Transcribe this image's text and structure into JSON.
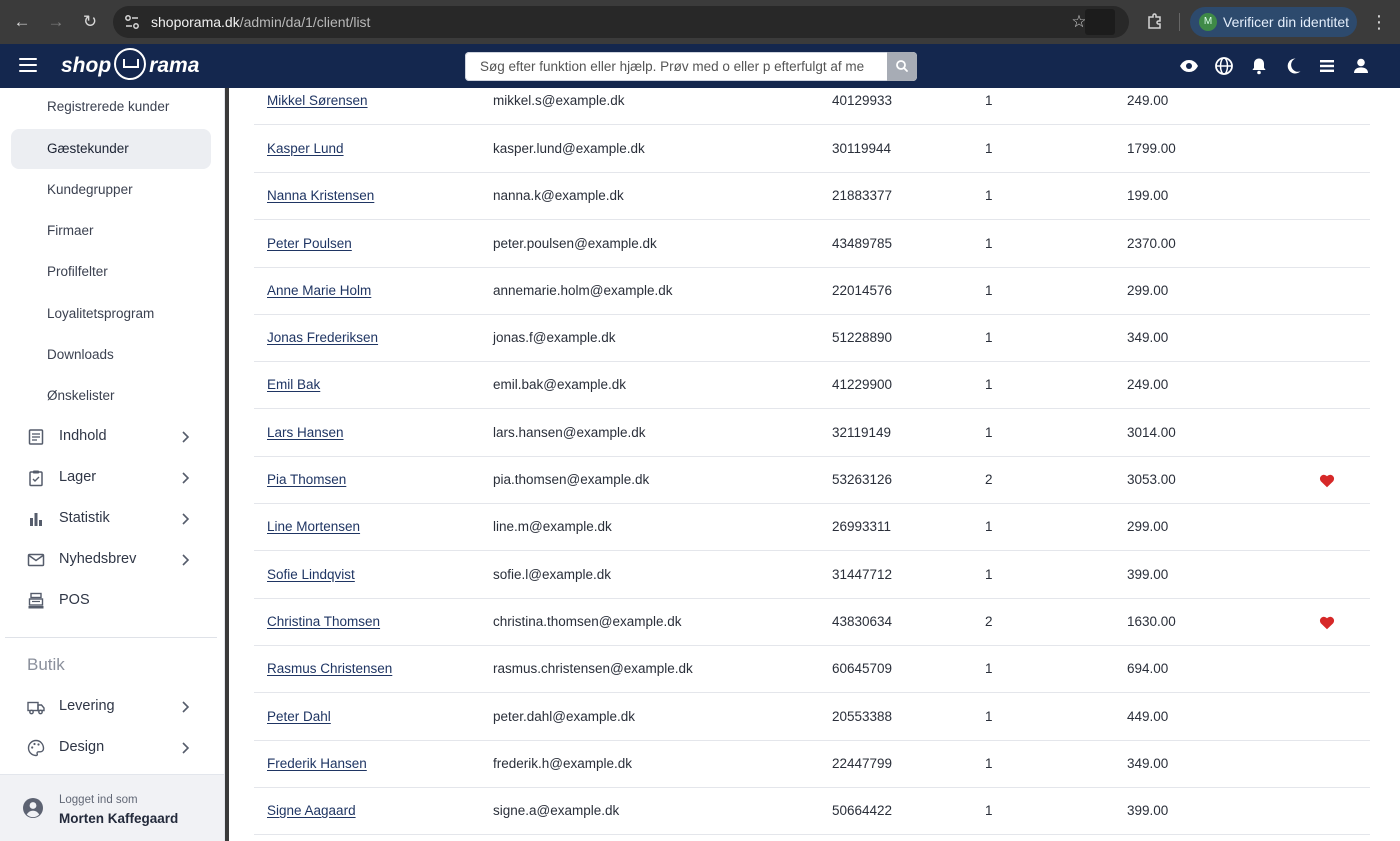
{
  "browser": {
    "url_host": "shoporama.dk",
    "url_path": "/admin/da/1/client/list",
    "verify_label": "Verificer din identitet",
    "verify_avatar": "M"
  },
  "header": {
    "logo_left": "shop",
    "logo_right": "rama",
    "search_placeholder": "Søg efter funktion eller hjælp. Prøv med o eller p efterfulgt af me",
    "icons": [
      "eye-icon",
      "globe-icon",
      "bell-icon",
      "moon-icon",
      "stack-icon",
      "user-icon"
    ]
  },
  "sidebar": {
    "sub_items": [
      {
        "label": "Registrerede kunder",
        "active": false
      },
      {
        "label": "Gæstekunder",
        "active": true
      },
      {
        "label": "Kundegrupper",
        "active": false
      },
      {
        "label": "Firmaer",
        "active": false
      },
      {
        "label": "Profilfelter",
        "active": false
      },
      {
        "label": "Loyalitetsprogram",
        "active": false
      },
      {
        "label": "Downloads",
        "active": false
      },
      {
        "label": "Ønskelister",
        "active": false
      }
    ],
    "nav_items": [
      {
        "label": "Indhold",
        "icon": "document-icon"
      },
      {
        "label": "Lager",
        "icon": "clipboard-icon"
      },
      {
        "label": "Statistik",
        "icon": "bar-chart-icon"
      },
      {
        "label": "Nyhedsbrev",
        "icon": "mail-icon"
      },
      {
        "label": "POS",
        "icon": "cash-register-icon"
      }
    ],
    "section_title": "Butik",
    "shop_items": [
      {
        "label": "Levering",
        "icon": "truck-icon"
      },
      {
        "label": "Design",
        "icon": "palette-icon"
      }
    ],
    "footer": {
      "logged_in_label": "Logget ind som",
      "user_name": "Morten Kaffegaard"
    }
  },
  "table": {
    "rows": [
      {
        "name": "Mikkel Sørensen",
        "email": "mikkel.s@example.dk",
        "phone": "40129933",
        "orders": "1",
        "total": "249.00",
        "favorite": false
      },
      {
        "name": "Kasper Lund",
        "email": "kasper.lund@example.dk",
        "phone": "30119944",
        "orders": "1",
        "total": "1799.00",
        "favorite": false
      },
      {
        "name": "Nanna Kristensen",
        "email": "nanna.k@example.dk",
        "phone": "21883377",
        "orders": "1",
        "total": "199.00",
        "favorite": false
      },
      {
        "name": "Peter Poulsen",
        "email": "peter.poulsen@example.dk",
        "phone": "43489785",
        "orders": "1",
        "total": "2370.00",
        "favorite": false
      },
      {
        "name": "Anne Marie Holm",
        "email": "annemarie.holm@example.dk",
        "phone": "22014576",
        "orders": "1",
        "total": "299.00",
        "favorite": false
      },
      {
        "name": "Jonas Frederiksen",
        "email": "jonas.f@example.dk",
        "phone": "51228890",
        "orders": "1",
        "total": "349.00",
        "favorite": false
      },
      {
        "name": "Emil Bak",
        "email": "emil.bak@example.dk",
        "phone": "41229900",
        "orders": "1",
        "total": "249.00",
        "favorite": false
      },
      {
        "name": "Lars Hansen",
        "email": "lars.hansen@example.dk",
        "phone": "32119149",
        "orders": "1",
        "total": "3014.00",
        "favorite": false
      },
      {
        "name": "Pia Thomsen",
        "email": "pia.thomsen@example.dk",
        "phone": "53263126",
        "orders": "2",
        "total": "3053.00",
        "favorite": true
      },
      {
        "name": "Line Mortensen",
        "email": "line.m@example.dk",
        "phone": "26993311",
        "orders": "1",
        "total": "299.00",
        "favorite": false
      },
      {
        "name": "Sofie Lindqvist",
        "email": "sofie.l@example.dk",
        "phone": "31447712",
        "orders": "1",
        "total": "399.00",
        "favorite": false
      },
      {
        "name": "Christina Thomsen",
        "email": "christina.thomsen@example.dk",
        "phone": "43830634",
        "orders": "2",
        "total": "1630.00",
        "favorite": true
      },
      {
        "name": "Rasmus Christensen",
        "email": "rasmus.christensen@example.dk",
        "phone": "60645709",
        "orders": "1",
        "total": "694.00",
        "favorite": false
      },
      {
        "name": "Peter Dahl",
        "email": "peter.dahl@example.dk",
        "phone": "20553388",
        "orders": "1",
        "total": "449.00",
        "favorite": false
      },
      {
        "name": "Frederik Hansen",
        "email": "frederik.h@example.dk",
        "phone": "22447799",
        "orders": "1",
        "total": "349.00",
        "favorite": false
      },
      {
        "name": "Signe Aagaard",
        "email": "signe.a@example.dk",
        "phone": "50664422",
        "orders": "1",
        "total": "399.00",
        "favorite": false
      }
    ]
  },
  "colors": {
    "header_bg": "#14274e",
    "chrome_bg": "#3b3b3b",
    "link": "#1f3563",
    "heart": "#d62828",
    "active_item_bg": "#eceef2"
  }
}
